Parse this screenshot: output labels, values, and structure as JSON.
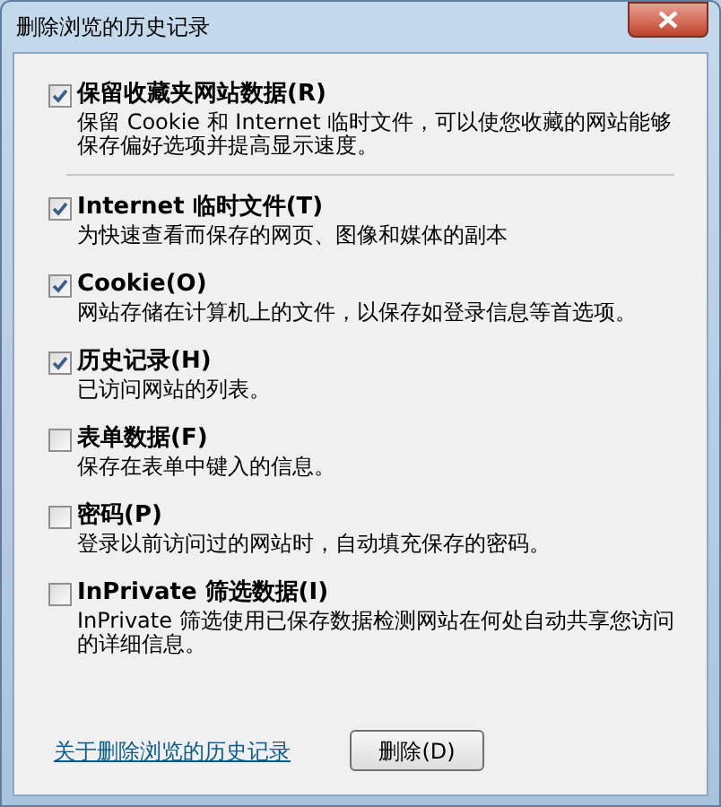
{
  "window": {
    "title": "删除浏览的历史记录"
  },
  "options": [
    {
      "label": "保留收藏夹网站数据(R)",
      "description": "保留 Cookie 和 Internet 临时文件，可以使您收藏的网站能够保存偏好选项并提高显示速度。",
      "checked": true,
      "separator_after": true
    },
    {
      "label": "Internet 临时文件(T)",
      "description": "为快速查看而保存的网页、图像和媒体的副本",
      "checked": true
    },
    {
      "label": "Cookie(O)",
      "description": "网站存储在计算机上的文件，以保存如登录信息等首选项。",
      "checked": true
    },
    {
      "label": "历史记录(H)",
      "description": "已访问网站的列表。",
      "checked": true
    },
    {
      "label": "表单数据(F)",
      "description": "保存在表单中键入的信息。",
      "checked": false
    },
    {
      "label": "密码(P)",
      "description": "登录以前访问过的网站时，自动填充保存的密码。",
      "checked": false
    },
    {
      "label": "InPrivate 筛选数据(I)",
      "description": "InPrivate 筛选使用已保存数据检测网站在何处自动共享您访问的详细信息。",
      "checked": false
    }
  ],
  "help_link": "关于删除浏览的历史记录",
  "buttons": [
    "删除(D)"
  ]
}
